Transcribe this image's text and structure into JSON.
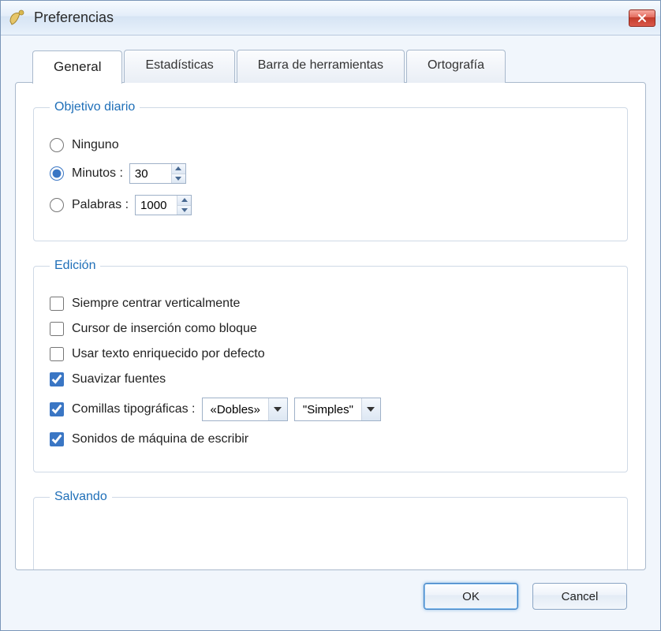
{
  "window": {
    "title": "Preferencias"
  },
  "tabs": [
    {
      "label": "General",
      "active": true
    },
    {
      "label": "Estadísticas",
      "active": false
    },
    {
      "label": "Barra de herramientas",
      "active": false
    },
    {
      "label": "Ortografía",
      "active": false
    }
  ],
  "groups": {
    "daily_goal": {
      "legend": "Objetivo diario",
      "none_label": "Ninguno",
      "minutes_label": "Minutos :",
      "minutes_value": "30",
      "words_label": "Palabras :",
      "words_value": "1000",
      "selected": "minutes"
    },
    "editing": {
      "legend": "Edición",
      "center_label": "Siempre centrar verticalmente",
      "center_checked": false,
      "block_cursor_label": "Cursor de inserción como bloque",
      "block_cursor_checked": false,
      "richtext_label": "Usar texto enriquecido por defecto",
      "richtext_checked": false,
      "smooth_label": "Suavizar fuentes",
      "smooth_checked": true,
      "quotes_label": "Comillas tipográficas :",
      "quotes_checked": true,
      "quotes_double_value": "«Dobles»",
      "quotes_single_value": "\"Simples\"",
      "typewriter_label": "Sonidos de máquina de escribir",
      "typewriter_checked": true
    },
    "saving": {
      "legend": "Salvando"
    }
  },
  "buttons": {
    "ok": "OK",
    "cancel": "Cancel"
  }
}
